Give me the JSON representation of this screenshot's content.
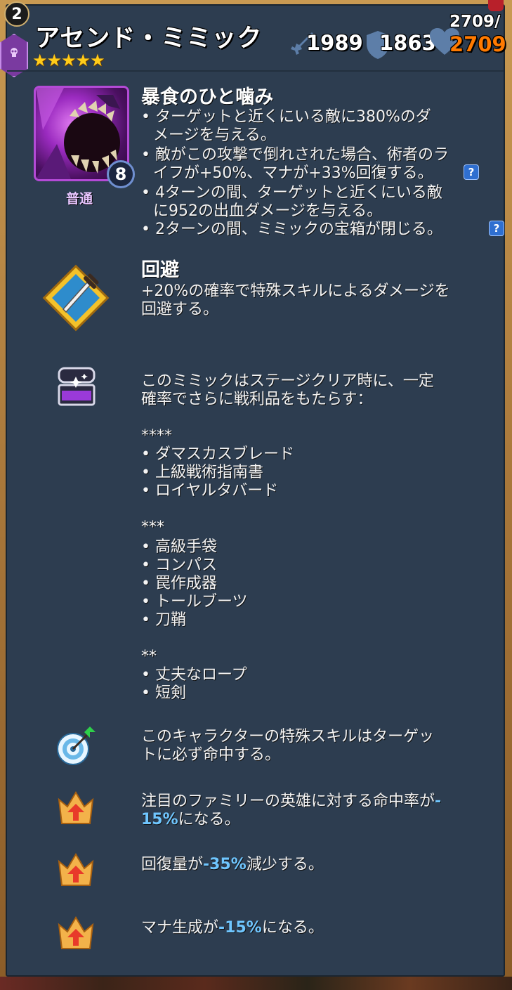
{
  "header": {
    "level": "2",
    "hero_name": "アセンド・ミミック",
    "stars": "★★★★★",
    "attack": "1989",
    "defense": "1863",
    "health_max": "2709/",
    "health_current": "2709",
    "class_icon": "skull-icon"
  },
  "special_skill": {
    "icon": "mimic-jaws-portrait",
    "mana_speed_number": "8",
    "mana_speed_label": "普通",
    "title": "暴食のひと噛み",
    "lines": [
      "• ターゲットと近くにいる敵に380%のダ",
      "メージを与える。",
      "• 敵がこの攻撃で倒れされた場合、術者のラ",
      "イフが+50%、マナが+33%回復する。",
      "• 4ターンの間、ターゲットと近くにいる敵",
      "に952の出血ダメージを与える。",
      "• 2ターンの間、ミミックの宝箱が閉じる。"
    ],
    "help_label": "?"
  },
  "traits": [
    {
      "icon": "dagger-dodge-icon",
      "title": "回避",
      "lines": [
        "+20%の確率で特殊スキルによるダメージを",
        "回避する。"
      ]
    },
    {
      "icon": "treasure-chest-icon",
      "lines": [
        "このミミックはステージクリア時に、一定",
        "確率でさらに戦利品をもたらす：",
        "",
        "****",
        "• ダマスカスブレード",
        "• 上級戦術指南書",
        "• ロイヤルタバード",
        "",
        "***",
        "• 高級手袋",
        "• コンパス",
        "• 罠作成器",
        "• トールブーツ",
        "• 刀鞘",
        "",
        "**",
        "• 丈夫なロープ",
        "• 短剣"
      ]
    },
    {
      "icon": "target-arrow-icon",
      "lines": [
        "このキャラクターの特殊スキルはターゲッ",
        "トに必ず命中する。"
      ]
    },
    {
      "icon": "crown-debuff-icon",
      "line1_prefix": "注目のファミリーの英雄に対する命中率が",
      "line1_value": "-",
      "line2_value": "15%",
      "line2_suffix": "になる。"
    },
    {
      "icon": "crown-debuff-icon",
      "prefix": "回復量が",
      "value": "-35%",
      "suffix": "減少する。"
    },
    {
      "icon": "crown-debuff-icon",
      "prefix": "マナ生成が",
      "value": "-15%",
      "suffix": "になる。"
    }
  ],
  "colors": {
    "panel_bg": "#2d3d50",
    "accent_blue": "#6fc6ff",
    "health_orange": "#ff7a00",
    "star_gold": "#ffcc1a",
    "frame_gold": "#c99a52"
  }
}
